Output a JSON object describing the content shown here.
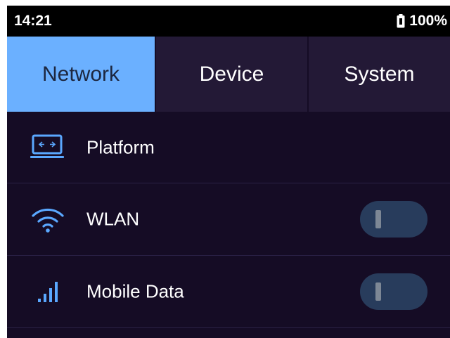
{
  "status_bar": {
    "time": "14:21",
    "battery_percent": "100%",
    "battery_icon": "battery-full-icon"
  },
  "tabs": [
    {
      "label": "Network",
      "active": true
    },
    {
      "label": "Device",
      "active": false
    },
    {
      "label": "System",
      "active": false
    }
  ],
  "items": [
    {
      "label": "Platform",
      "icon": "platform-laptop-icon"
    },
    {
      "label": "WLAN",
      "icon": "wifi-icon",
      "toggle_on": false
    },
    {
      "label": "Mobile Data",
      "icon": "signal-bars-icon",
      "toggle_on": false
    }
  ],
  "colors": {
    "background": "#150c25",
    "tab_bar": "#231936",
    "active_tab": "#6bb0ff",
    "icon_accent": "#5aa8ff",
    "toggle_off": "#283c5c"
  }
}
